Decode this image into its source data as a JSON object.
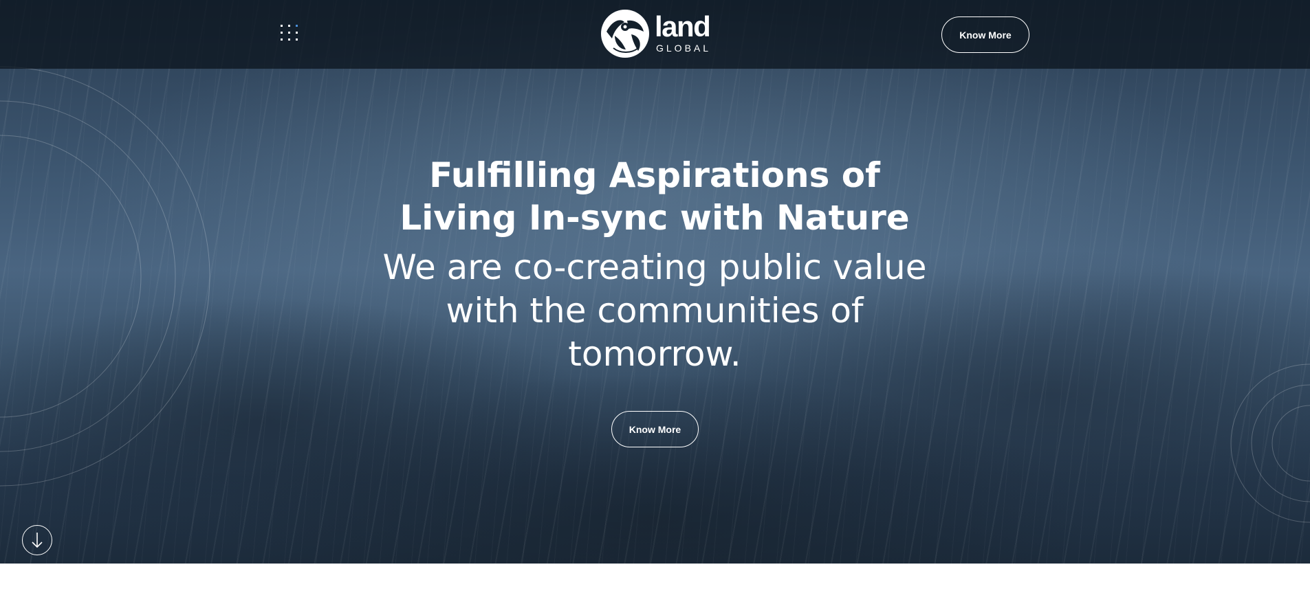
{
  "header": {
    "menu_icon": "grid-dots-icon",
    "logo": {
      "icon": "land-global-emblem-icon",
      "word": "land",
      "sub": "GLOBAL"
    },
    "cta_label": "Know More"
  },
  "hero": {
    "headline_line1": "Fulfilling Aspirations of",
    "headline_line2": "Living In-sync with Nature",
    "subline_line1": "We are co-creating public value",
    "subline_line2": "with the communities of",
    "subline_line3": "tomorrow.",
    "cta_label": "Know More",
    "scroll_icon": "arrow-down-icon"
  },
  "colors": {
    "text": "#ffffff",
    "topbar": "#0a121a",
    "hero_dark": "#1c2b3b",
    "hero_mid": "#4a6581",
    "menu_accent": "#4a90d9"
  }
}
